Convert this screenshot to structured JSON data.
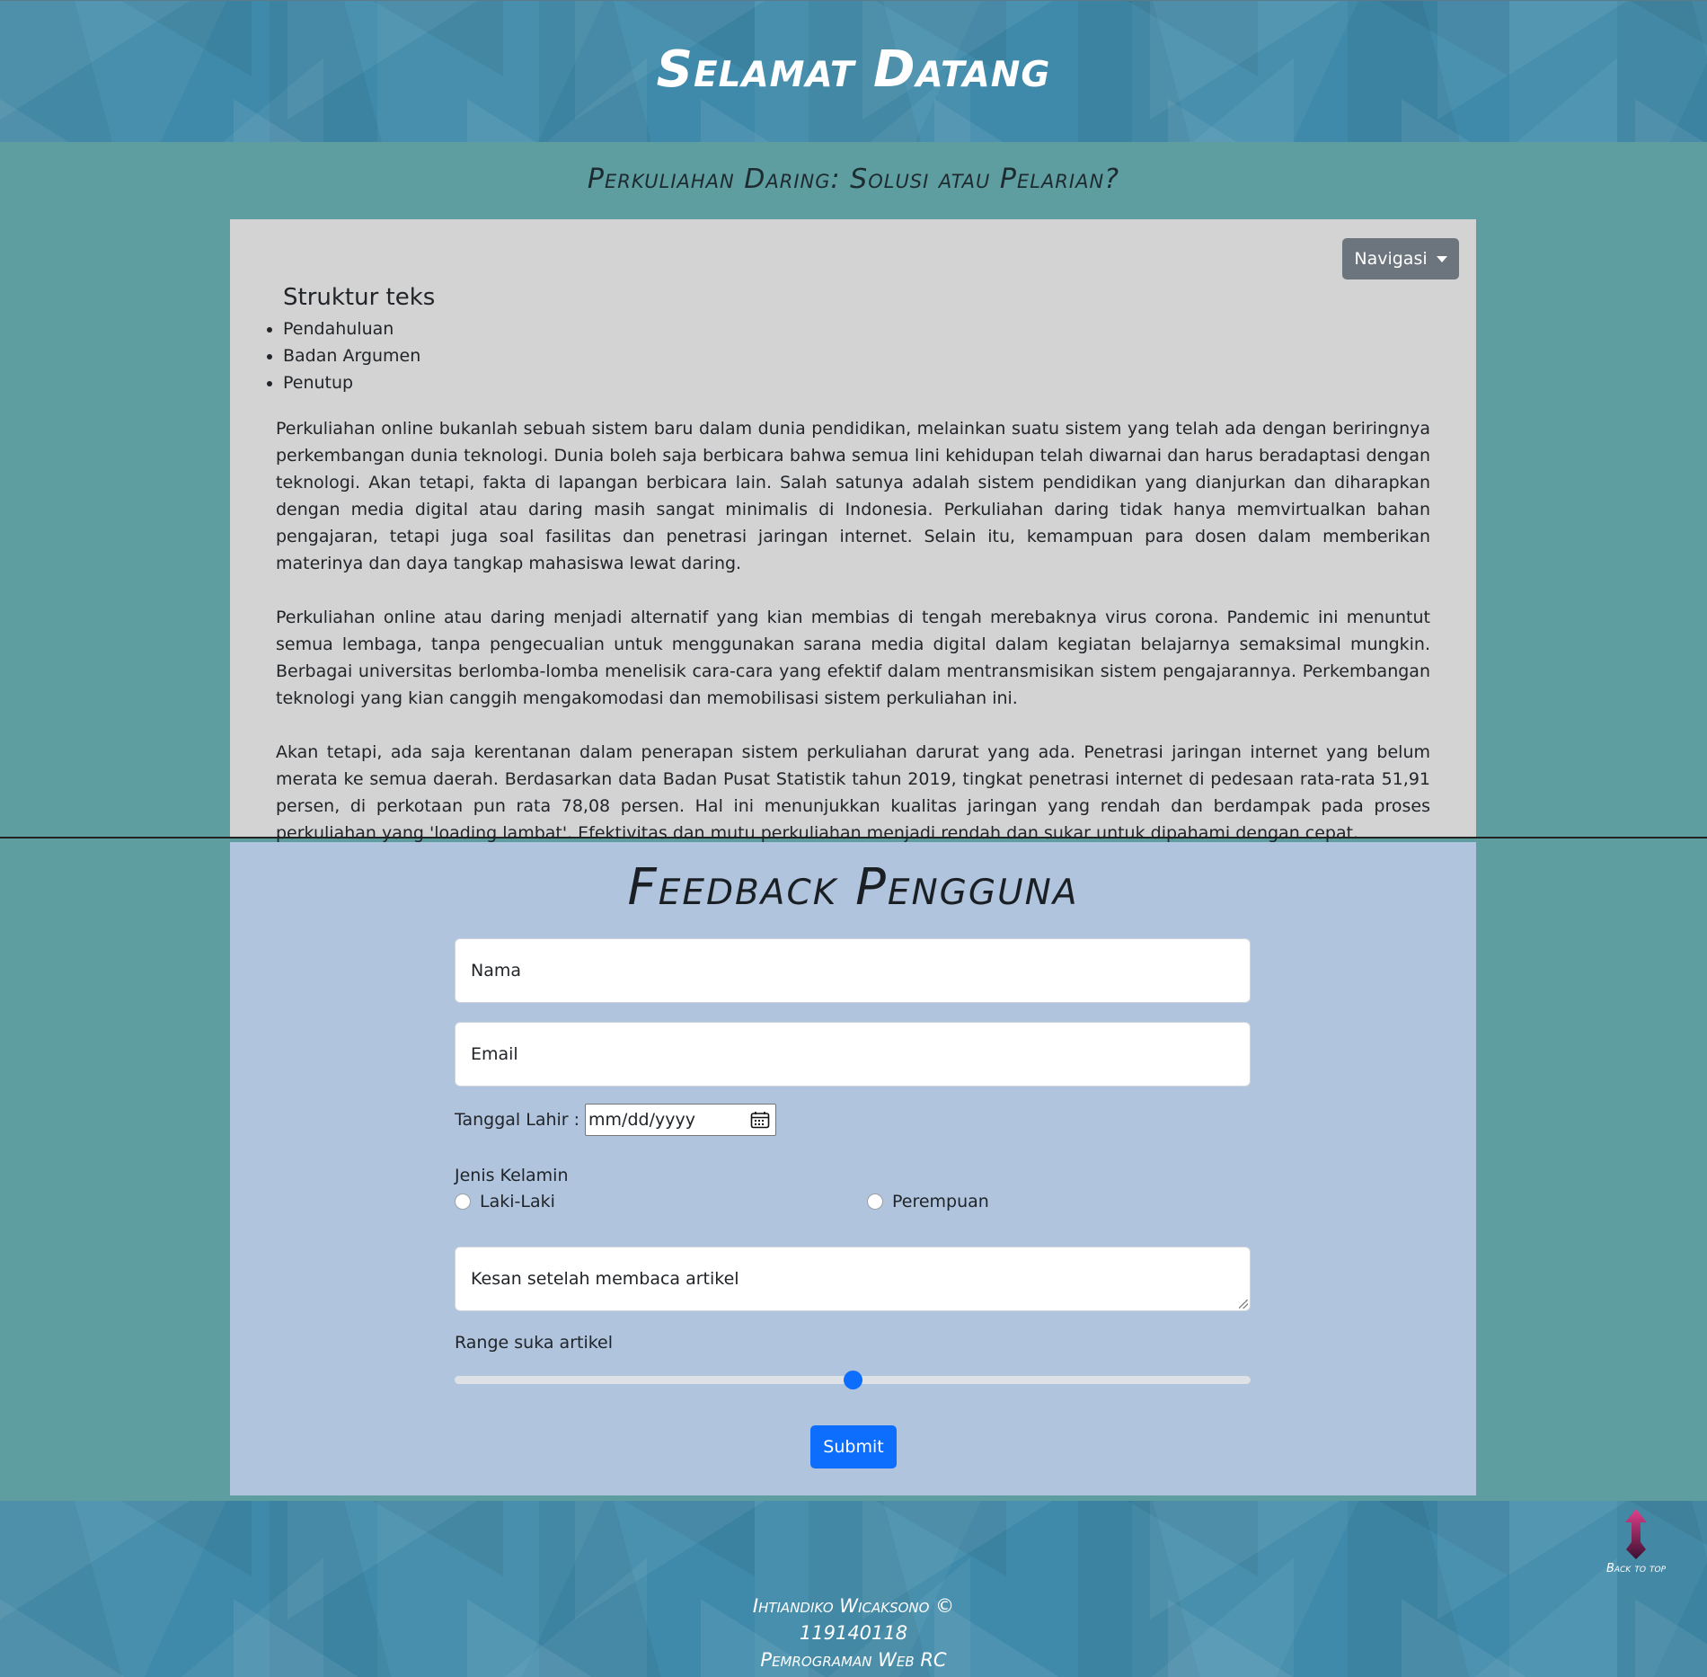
{
  "header": {
    "title": "Selamat Datang"
  },
  "article": {
    "subtitle": "Perkuliahan Daring: Solusi atau Pelarian?",
    "nav_button": "Navigasi",
    "structure_heading": "Struktur teks",
    "structure_items": [
      "Pendahuluan",
      "Badan Argumen",
      "Penutup"
    ],
    "paragraphs": [
      "Perkuliahan online bukanlah sebuah sistem baru dalam dunia pendidikan, melainkan suatu sistem yang telah ada dengan beriringnya perkembangan dunia teknologi. Dunia boleh saja berbicara bahwa semua lini kehidupan telah diwarnai dan harus beradaptasi dengan teknologi. Akan tetapi, fakta di lapangan berbicara lain. Salah satunya adalah sistem pendidikan yang dianjurkan dan diharapkan dengan media digital atau daring masih sangat minimalis di Indonesia. Perkuliahan daring tidak hanya memvirtualkan bahan pengajaran, tetapi juga soal fasilitas dan penetrasi jaringan internet. Selain itu, kemampuan para dosen dalam memberikan materinya dan daya tangkap mahasiswa lewat daring.",
      "Perkuliahan online atau daring menjadi alternatif yang kian membias di tengah merebaknya virus corona. Pandemic ini menuntut semua lembaga, tanpa pengecualian untuk menggunakan sarana media digital dalam kegiatan belajarnya semaksimal mungkin. Berbagai universitas berlomba-lomba menelisik cara-cara yang efektif dalam mentransmisikan sistem pengajarannya. Perkembangan teknologi yang kian canggih mengakomodasi dan memobilisasi sistem perkuliahan ini.",
      "Akan tetapi, ada saja kerentanan dalam penerapan sistem perkuliahan darurat yang ada. Penetrasi jaringan internet yang belum merata ke semua daerah. Berdasarkan data Badan Pusat Statistik tahun 2019, tingkat penetrasi internet di pedesaan rata-rata 51,91 persen, di perkotaan pun rata 78,08 persen. Hal ini menunjukkan kualitas jaringan yang rendah dan berdampak pada proses perkuliahan yang 'loading lambat'. Efektivitas dan mutu perkuliahan menjadi rendah dan sukar untuk dipahami dengan cepat."
    ]
  },
  "feedback": {
    "title": "Feedback Pengguna",
    "name_placeholder": "Nama",
    "email_placeholder": "Email",
    "dob_label": "Tanggal Lahir :",
    "dob_placeholder": "mm/dd/yyyy",
    "gender_label": "Jenis Kelamin",
    "gender_options": [
      "Laki-Laki",
      "Perempuan"
    ],
    "impression_placeholder": "Kesan setelah membaca artikel",
    "range_label": "Range suka artikel",
    "range_value_fraction": 0.5,
    "submit_label": "Submit",
    "accent_color": "#0d6efd"
  },
  "footer": {
    "back_to_top": "Back to top",
    "author": "Ihtiandiko Wicaksono ©",
    "nim": "119140118",
    "course": "Pemrograman Web RC"
  },
  "icons": {
    "calendar": "calendar-icon",
    "back_to_top": "arrow-up-icon",
    "dropdown": "chevron-down-icon"
  }
}
